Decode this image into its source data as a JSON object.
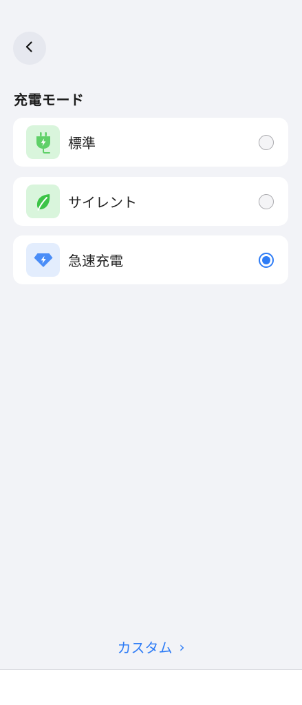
{
  "header": {
    "back_icon": "chevron-left-icon"
  },
  "section": {
    "title": "充電モード"
  },
  "modes": [
    {
      "label": "標準",
      "icon": "plug-icon",
      "icon_bg": "#d9f5dc",
      "icon_color": "#5fd068",
      "selected": false
    },
    {
      "label": "サイレント",
      "icon": "leaf-icon",
      "icon_bg": "#d9f5dc",
      "icon_color": "#3cc447",
      "selected": false
    },
    {
      "label": "急速充電",
      "icon": "diamond-bolt-icon",
      "icon_bg": "#e3edfd",
      "icon_color": "#4a8df7",
      "selected": true
    }
  ],
  "footer": {
    "custom_label": "カスタム",
    "custom_chevron": "›",
    "accent_color": "#2e7cf6"
  }
}
